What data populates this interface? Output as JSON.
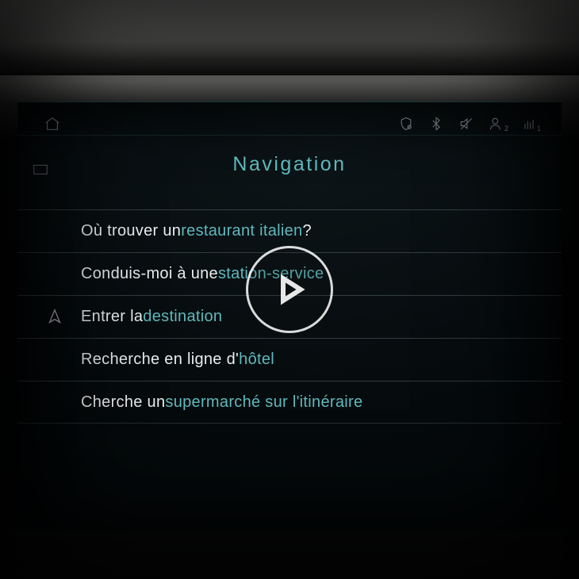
{
  "title": "Navigation",
  "status": {
    "user_badge": "2",
    "signal_label": "1"
  },
  "rows": [
    {
      "prefix": "Où trouver un ",
      "highlight": "restaurant italien",
      "suffix": "?"
    },
    {
      "prefix": "Conduis-moi à une ",
      "highlight": "station-service",
      "suffix": ""
    },
    {
      "prefix": "Entrer la ",
      "highlight": "destination",
      "suffix": "",
      "icon": "navigate"
    },
    {
      "prefix": "Recherche en ligne d'",
      "highlight": "hôtel",
      "suffix": ""
    },
    {
      "prefix": "Cherche un ",
      "highlight": "supermarché sur l'itinéraire",
      "suffix": ""
    }
  ]
}
